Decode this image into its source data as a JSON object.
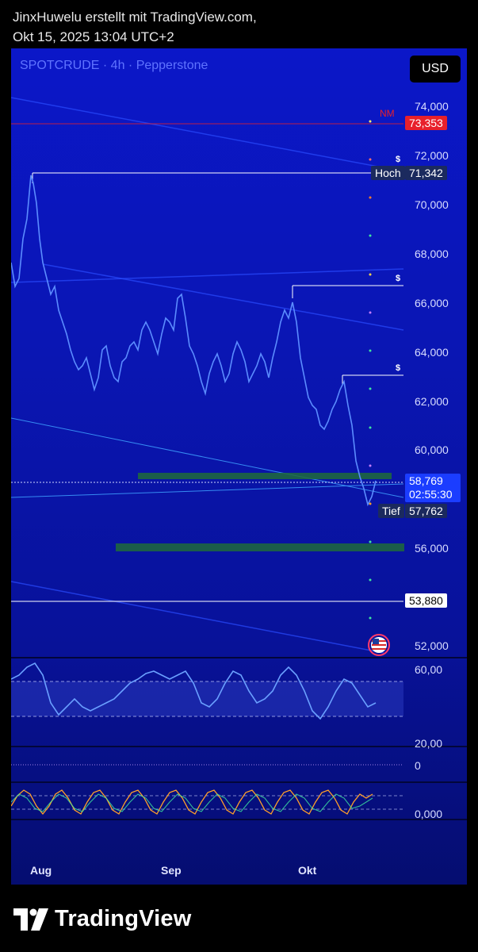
{
  "caption": {
    "line1": "JinxHuwelu erstellt mit TradingView.com,",
    "line2": "Okt 15, 2025 13:04 UTC+2"
  },
  "chart": {
    "symbol": "SPOTCRUDE · 4h · Pepperstone",
    "currency_button": "USD",
    "price_axis": [
      "74,000",
      "72,000",
      "70,000",
      "68,000",
      "66,000",
      "64,000",
      "62,000",
      "60,000",
      "56,000",
      "52,000"
    ],
    "markers": {
      "nm": {
        "label": "NM",
        "price": "73,353",
        "color": "#e8202b"
      },
      "high": {
        "label": "Hoch",
        "price": "71,342"
      },
      "current": {
        "price": "58,769",
        "countdown": "02:55:30"
      },
      "low": {
        "label": "Tief",
        "price": "57,762"
      },
      "level": {
        "price": "53,880"
      }
    },
    "dollar_marks": [
      "$",
      "$",
      "$"
    ],
    "rsi_axis": [
      "60,00",
      "20,00"
    ],
    "pane3_axis": "0",
    "pane4_axis": "0,000",
    "time_axis": [
      "Aug",
      "Sep",
      "Okt"
    ]
  },
  "logo": {
    "text": "TradingView"
  },
  "colors": {
    "accent": "#2962ff",
    "price_line": "#5b8cff",
    "zone": "#1e6b3a"
  }
}
